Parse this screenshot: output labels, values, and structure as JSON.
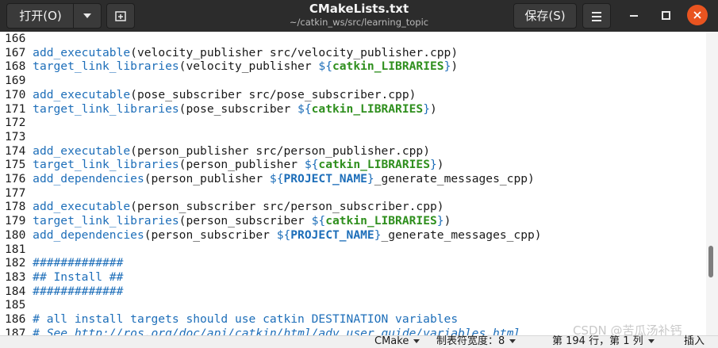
{
  "header": {
    "open_label": "打开(O)",
    "title": "CMakeLists.txt",
    "subtitle": "~/catkin_ws/src/learning_topic",
    "save_label": "保存(S)"
  },
  "editor": {
    "lines": [
      {
        "n": "166",
        "segs": []
      },
      {
        "n": "167",
        "segs": [
          {
            "t": "add_executable",
            "c": "kw"
          },
          {
            "t": "(velocity_publisher src/velocity_publisher.cpp)",
            "c": ""
          }
        ]
      },
      {
        "n": "168",
        "segs": [
          {
            "t": "target_link_libraries",
            "c": "kw"
          },
          {
            "t": "(velocity_publisher ",
            "c": ""
          },
          {
            "t": "${",
            "c": "kw"
          },
          {
            "t": "catkin_LIBRARIES",
            "c": "var"
          },
          {
            "t": "}",
            "c": "kw"
          },
          {
            "t": ")",
            "c": ""
          }
        ]
      },
      {
        "n": "169",
        "segs": []
      },
      {
        "n": "170",
        "segs": [
          {
            "t": "add_executable",
            "c": "kw"
          },
          {
            "t": "(pose_subscriber src/pose_subscriber.cpp)",
            "c": ""
          }
        ]
      },
      {
        "n": "171",
        "segs": [
          {
            "t": "target_link_libraries",
            "c": "kw"
          },
          {
            "t": "(pose_subscriber ",
            "c": ""
          },
          {
            "t": "${",
            "c": "kw"
          },
          {
            "t": "catkin_LIBRARIES",
            "c": "var"
          },
          {
            "t": "}",
            "c": "kw"
          },
          {
            "t": ")",
            "c": ""
          }
        ]
      },
      {
        "n": "172",
        "segs": []
      },
      {
        "n": "173",
        "segs": []
      },
      {
        "n": "174",
        "segs": [
          {
            "t": "add_executable",
            "c": "kw"
          },
          {
            "t": "(person_publisher src/person_publisher.cpp)",
            "c": ""
          }
        ]
      },
      {
        "n": "175",
        "segs": [
          {
            "t": "target_link_libraries",
            "c": "kw"
          },
          {
            "t": "(person_publisher ",
            "c": ""
          },
          {
            "t": "${",
            "c": "kw"
          },
          {
            "t": "catkin_LIBRARIES",
            "c": "var"
          },
          {
            "t": "}",
            "c": "kw"
          },
          {
            "t": ")",
            "c": ""
          }
        ]
      },
      {
        "n": "176",
        "segs": [
          {
            "t": "add_dependencies",
            "c": "kw"
          },
          {
            "t": "(person_publisher ",
            "c": ""
          },
          {
            "t": "${",
            "c": "kw"
          },
          {
            "t": "PROJECT_NAME",
            "c": "kw bold"
          },
          {
            "t": "}",
            "c": "kw"
          },
          {
            "t": "_generate_messages_cpp)",
            "c": ""
          }
        ]
      },
      {
        "n": "177",
        "segs": []
      },
      {
        "n": "178",
        "segs": [
          {
            "t": "add_executable",
            "c": "kw"
          },
          {
            "t": "(person_subscriber src/person_subscriber.cpp)",
            "c": ""
          }
        ]
      },
      {
        "n": "179",
        "segs": [
          {
            "t": "target_link_libraries",
            "c": "kw"
          },
          {
            "t": "(person_subscriber ",
            "c": ""
          },
          {
            "t": "${",
            "c": "kw"
          },
          {
            "t": "catkin_LIBRARIES",
            "c": "var"
          },
          {
            "t": "}",
            "c": "kw"
          },
          {
            "t": ")",
            "c": ""
          }
        ]
      },
      {
        "n": "180",
        "segs": [
          {
            "t": "add_dependencies",
            "c": "kw"
          },
          {
            "t": "(person_subscriber ",
            "c": ""
          },
          {
            "t": "${",
            "c": "kw"
          },
          {
            "t": "PROJECT_NAME",
            "c": "kw bold"
          },
          {
            "t": "}",
            "c": "kw"
          },
          {
            "t": "_generate_messages_cpp)",
            "c": ""
          }
        ]
      },
      {
        "n": "181",
        "segs": []
      },
      {
        "n": "182",
        "segs": [
          {
            "t": "#############",
            "c": "cm"
          }
        ]
      },
      {
        "n": "183",
        "segs": [
          {
            "t": "## Install ##",
            "c": "cm"
          }
        ]
      },
      {
        "n": "184",
        "segs": [
          {
            "t": "#############",
            "c": "cm"
          }
        ]
      },
      {
        "n": "185",
        "segs": []
      },
      {
        "n": "186",
        "segs": [
          {
            "t": "# all install targets should use catkin DESTINATION variables",
            "c": "cm"
          }
        ]
      },
      {
        "n": "187",
        "segs": [
          {
            "t": "# See http://ros.org/doc/api/catkin/html/adv_user_guide/variables.html",
            "c": "cm ital"
          }
        ]
      }
    ]
  },
  "statusbar": {
    "language": "CMake",
    "tab_width": "制表符宽度：8",
    "position": "第 194 行，第 1 列",
    "mode": "插入"
  },
  "watermark": "CSDN @苦瓜汤补钙",
  "colors": {
    "keyword": "#1d6eb9",
    "variable": "#2f8f1e",
    "accent_close": "#e95420",
    "header_bg": "#2c2c2c"
  }
}
